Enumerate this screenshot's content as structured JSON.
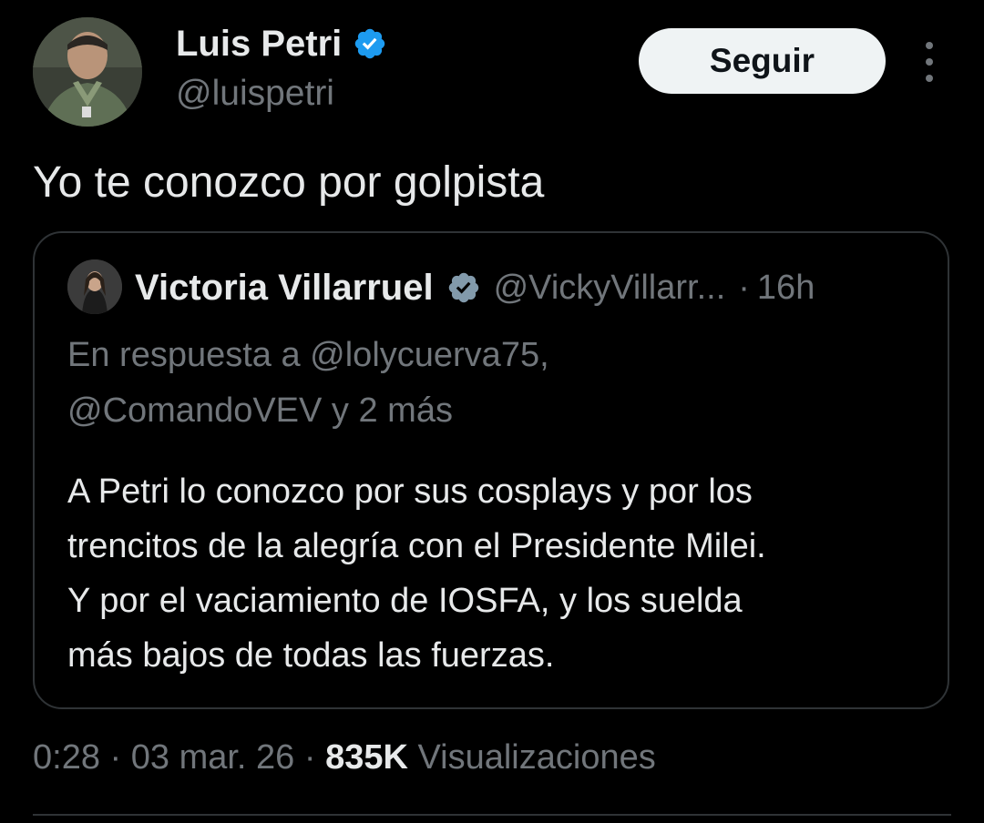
{
  "author": {
    "display_name": "Luis Petri",
    "handle": "@luispetri",
    "verified_icon": "verified-badge-icon"
  },
  "follow_button": {
    "label": "Seguir"
  },
  "more_menu": {
    "icon": "more-vertical-icon"
  },
  "tweet": {
    "text": "Yo te conozco por golpista"
  },
  "quoted_tweet": {
    "display_name": "Victoria Villarruel",
    "handle": "@VickyVillarr...",
    "separator": "·",
    "time": "16h",
    "reply_line_1": "En respuesta a @lolycuerva75,",
    "reply_line_2": "@ComandoVEV y 2 más",
    "text_line_1": "A Petri lo conozco por sus cosplays y por los",
    "text_line_2": "trencitos de la alegría con el Presidente Milei.",
    "text_line_3": "Y por el vaciamiento de IOSFA, y los suelda",
    "text_line_4": "más bajos de todas las fuerzas."
  },
  "meta": {
    "time": "0:28",
    "sep1": " · ",
    "date": "03 mar. 26",
    "sep2": " · ",
    "views_count": "835K",
    "views_label": " Visualizaciones"
  },
  "colors": {
    "background": "#000000",
    "text_primary": "#e7e9ea",
    "text_secondary": "#71767b",
    "verified_blue": "#1d9bf0",
    "verified_gray": "#829aab",
    "border": "#2f3336"
  }
}
